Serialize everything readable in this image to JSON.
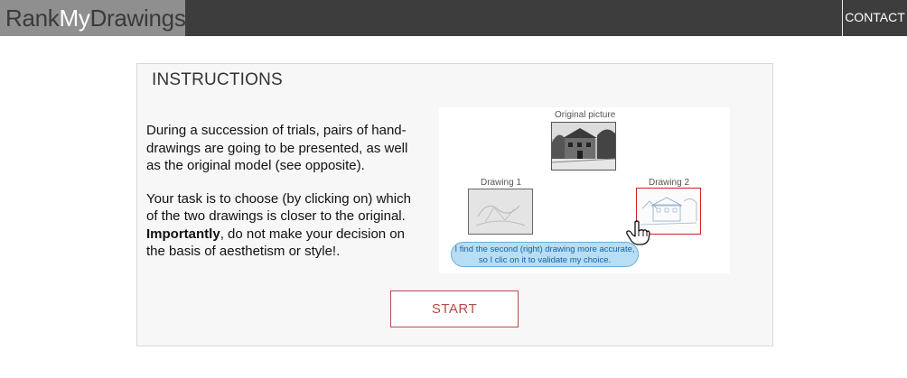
{
  "brand": {
    "part1": "Rank",
    "part2": "My",
    "part3": "Drawings"
  },
  "nav": {
    "contact_label": "CONTACT"
  },
  "panel": {
    "title": "INSTRUCTIONS",
    "paragraph1": "During a succession of trials, pairs of hand-drawings are going to be presented, as well as the original model (see opposite).",
    "paragraph2_before": "Your task is to choose (by clicking on) which of the two drawings is closer to the original. ",
    "paragraph2_bold": "Importantly",
    "paragraph2_after": ", do not make your decision on the basis of aesthetism or style!.",
    "start_label": "START"
  },
  "illustration": {
    "original_caption": "Original picture",
    "drawing1_caption": "Drawing 1",
    "drawing2_caption": "Drawing 2",
    "bubble_line1": "I find the second (right) drawing more accurate,",
    "bubble_line2": "so I clic on it to validate my choice."
  },
  "colors": {
    "navbar": "#3d3d3d",
    "brand_bg": "#8f8f8f",
    "accent": "#b84a4a",
    "bubble": "#b7def4"
  }
}
